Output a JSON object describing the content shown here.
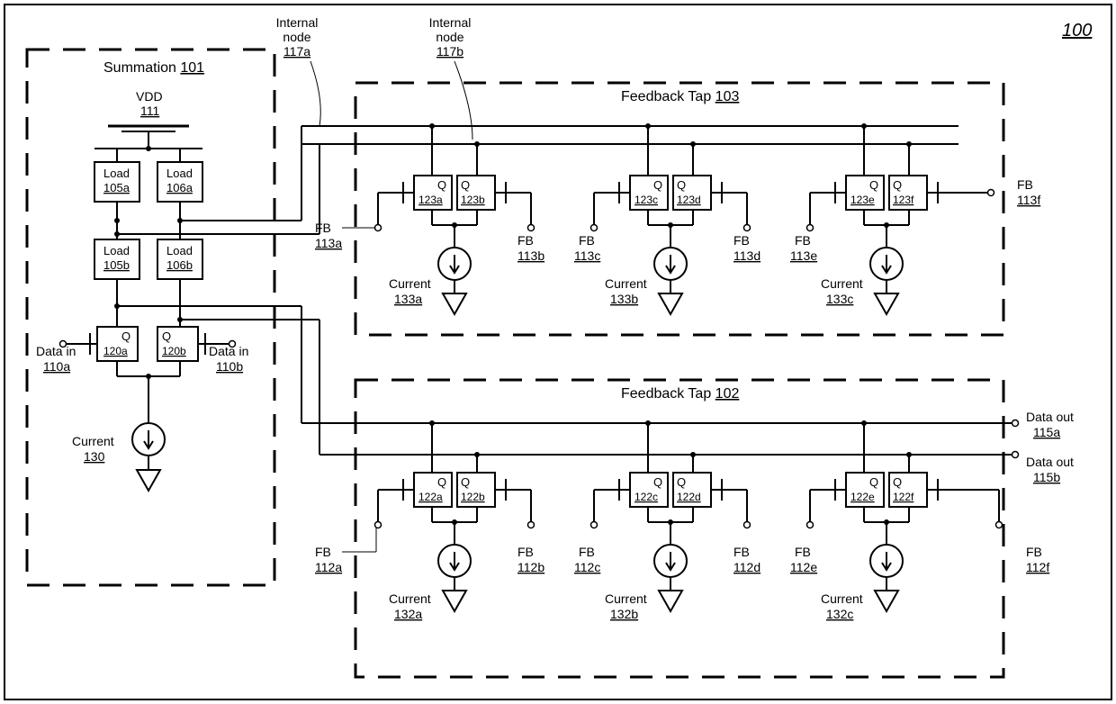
{
  "figure_ref": "100",
  "summation": {
    "title": "Summation",
    "ref": "101",
    "vdd": {
      "label": "VDD",
      "ref": "111"
    },
    "loads": {
      "105a": {
        "label": "Load",
        "ref": "105a"
      },
      "106a": {
        "label": "Load",
        "ref": "106a"
      },
      "105b": {
        "label": "Load",
        "ref": "105b"
      },
      "106b": {
        "label": "Load",
        "ref": "106b"
      }
    },
    "q": {
      "120a": {
        "label": "Q",
        "ref": "120a"
      },
      "120b": {
        "label": "Q",
        "ref": "120b"
      }
    },
    "data_in_a": {
      "label": "Data in",
      "ref": "110a"
    },
    "data_in_b": {
      "label": "Data in",
      "ref": "110b"
    },
    "current": {
      "label": "Current",
      "ref": "130"
    }
  },
  "internal_nodes": {
    "a": {
      "label": "Internal",
      "label2": "node",
      "ref": "117a"
    },
    "b": {
      "label": "Internal",
      "label2": "node",
      "ref": "117b"
    }
  },
  "feedback_tap_103": {
    "title": "Feedback Tap",
    "ref": "103",
    "pairs": [
      {
        "qa": {
          "label": "Q",
          "ref": "123a"
        },
        "qb": {
          "label": "Q",
          "ref": "123b"
        },
        "fba": {
          "label": "FB",
          "ref": "113a"
        },
        "fbb": {
          "label": "FB",
          "ref": "113b"
        },
        "current": {
          "label": "Current",
          "ref": "133a"
        }
      },
      {
        "qa": {
          "label": "Q",
          "ref": "123c"
        },
        "qb": {
          "label": "Q",
          "ref": "123d"
        },
        "fba": {
          "label": "FB",
          "ref": "113c"
        },
        "fbb": {
          "label": "FB",
          "ref": "113d"
        },
        "current": {
          "label": "Current",
          "ref": "133b"
        }
      },
      {
        "qa": {
          "label": "Q",
          "ref": "123e"
        },
        "qb": {
          "label": "Q",
          "ref": "123f"
        },
        "fba": {
          "label": "FB",
          "ref": "113e"
        },
        "fbb": {
          "label": "FB",
          "ref": "113f"
        },
        "current": {
          "label": "Current",
          "ref": "133c"
        }
      }
    ]
  },
  "feedback_tap_102": {
    "title": "Feedback Tap",
    "ref": "102",
    "pairs": [
      {
        "qa": {
          "label": "Q",
          "ref": "122a"
        },
        "qb": {
          "label": "Q",
          "ref": "122b"
        },
        "fba": {
          "label": "FB",
          "ref": "112a"
        },
        "fbb": {
          "label": "FB",
          "ref": "112b"
        },
        "current": {
          "label": "Current",
          "ref": "132a"
        }
      },
      {
        "qa": {
          "label": "Q",
          "ref": "122c"
        },
        "qb": {
          "label": "Q",
          "ref": "122d"
        },
        "fba": {
          "label": "FB",
          "ref": "112c"
        },
        "fbb": {
          "label": "FB",
          "ref": "112d"
        },
        "current": {
          "label": "Current",
          "ref": "132b"
        }
      },
      {
        "qa": {
          "label": "Q",
          "ref": "122e"
        },
        "qb": {
          "label": "Q",
          "ref": "122f"
        },
        "fba": {
          "label": "FB",
          "ref": "112e"
        },
        "fbb": {
          "label": "FB",
          "ref": "112f"
        },
        "current": {
          "label": "Current",
          "ref": "132c"
        }
      }
    ]
  },
  "data_out_a": {
    "label": "Data out",
    "ref": "115a"
  },
  "data_out_b": {
    "label": "Data out",
    "ref": "115b"
  }
}
